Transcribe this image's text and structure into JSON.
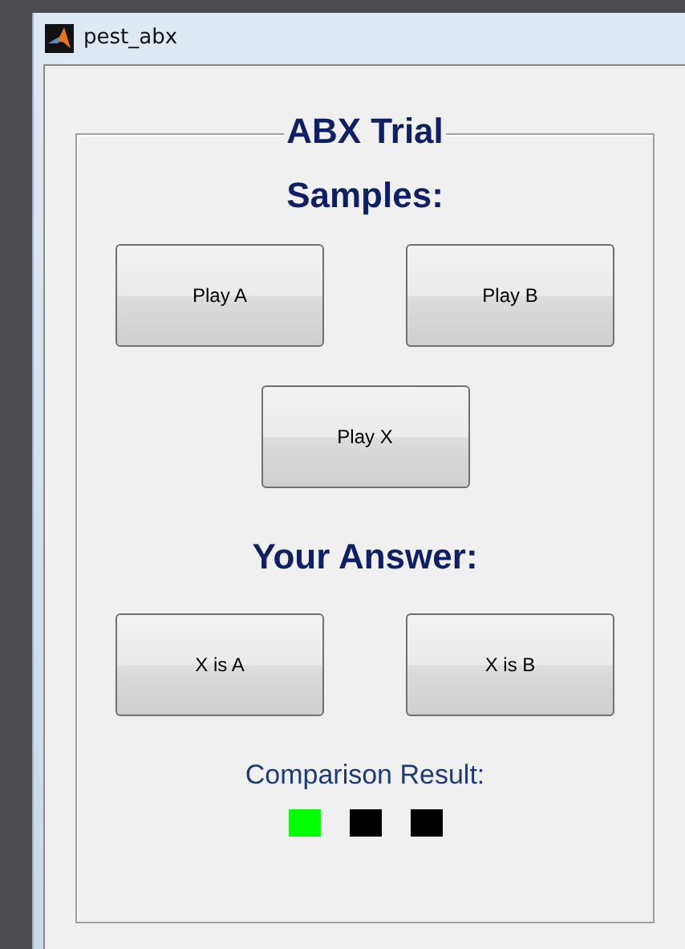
{
  "window": {
    "title": "pest_abx"
  },
  "panel": {
    "title": "ABX Trial"
  },
  "samples": {
    "heading": "Samples:",
    "buttons": [
      "Play A",
      "Play B",
      "Play X"
    ]
  },
  "answer": {
    "heading": "Your Answer:",
    "buttons": [
      "X is A",
      "X is B"
    ]
  },
  "result": {
    "label": "Comparison Result:",
    "indicators": [
      {
        "color": "#00ff00"
      },
      {
        "color": "#000000"
      },
      {
        "color": "#000000"
      }
    ]
  }
}
